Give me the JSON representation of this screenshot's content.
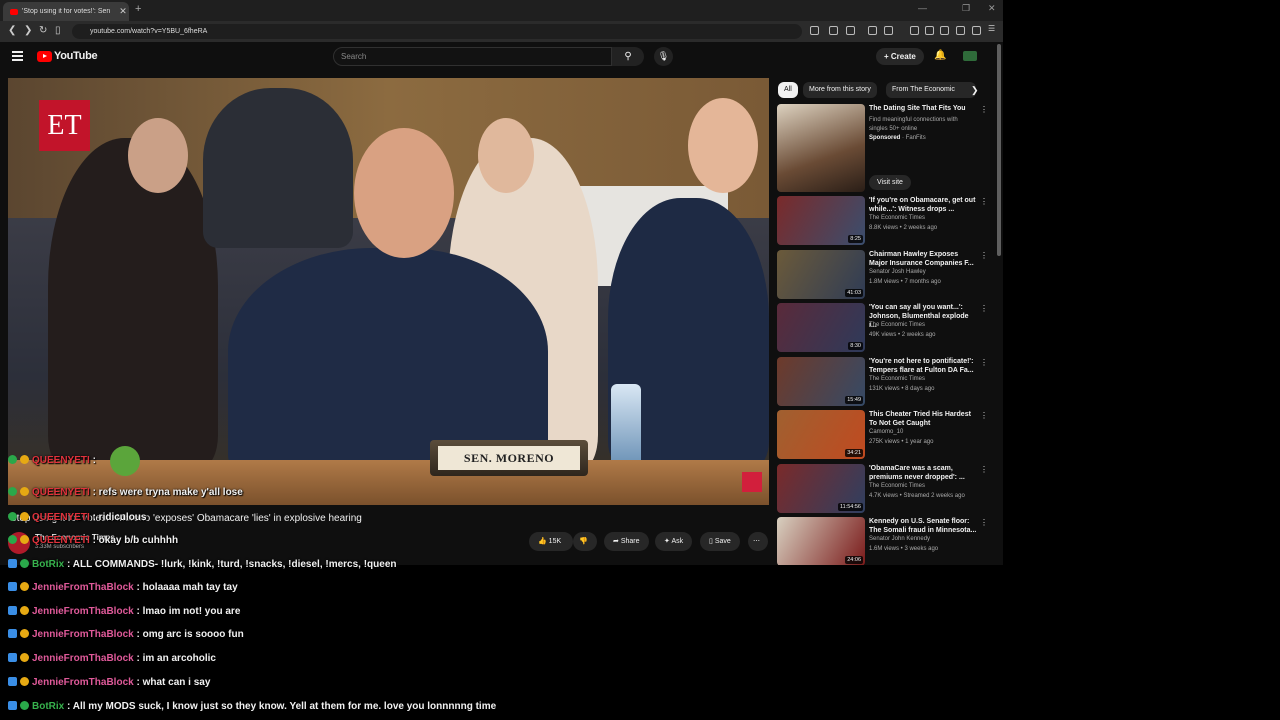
{
  "browser": {
    "tab_title": "'Stop using it for votes!': Sen",
    "tab_close": "✕",
    "new_tab": "+",
    "url": "youtube.com/watch?v=Y5BU_6fheRA",
    "controls": [
      "—",
      "❐",
      "✕"
    ]
  },
  "youtube": {
    "logo_text": "YouTube",
    "search_placeholder": "Search",
    "create_label": "Create"
  },
  "video": {
    "nameplate": "SEN. MORENO",
    "logo": "ET",
    "title": "'Stop using it for votes!': Moreno 'exposes' Obamacare 'lies' in explosive hearing",
    "channel": "The Economic Times",
    "subscribers": "3.33M subscribers",
    "likes": "15K",
    "share": "Share",
    "ask": "Ask",
    "save": "Save"
  },
  "sidebar": {
    "chips": [
      "All",
      "More from this story",
      "From The Economic"
    ],
    "ad": {
      "title": "The Dating Site That Fits You",
      "desc": "Find meaningful connections with singles 50+ online",
      "sponsored": "Sponsored",
      "advertiser": "FanFits",
      "visit": "Visit site"
    },
    "videos": [
      {
        "title": "'If you're on Obamacare, get out while...': Witness drops ...",
        "channel": "The Economic Times",
        "meta": "8.8K views • 2 weeks ago",
        "duration": "8:25"
      },
      {
        "title": "Chairman Hawley Exposes Major Insurance Companies F...",
        "channel": "Senator Josh Hawley",
        "meta": "1.8M views • 7 months ago",
        "duration": "41:03"
      },
      {
        "title": "'You can say all you want...': Johnson, Blumenthal explode i...",
        "channel": "The Economic Times",
        "meta": "49K views • 2 weeks ago",
        "duration": "8:30"
      },
      {
        "title": "'You're not here to pontificate!': Tempers flare at Fulton DA Fa...",
        "channel": "The Economic Times",
        "meta": "131K views • 8 days ago",
        "duration": "15:49"
      },
      {
        "title": "This Cheater Tried His Hardest To Not Get Caught",
        "channel": "Camomo_10",
        "meta": "275K views • 1 year ago",
        "duration": "34:21"
      },
      {
        "title": "'ObamaCare was a scam, premiums never dropped': ...",
        "channel": "The Economic Times",
        "meta": "4.7K views • Streamed 2 weeks ago",
        "duration": "11:54:56"
      },
      {
        "title": "Kennedy on U.S. Senate floor: The Somali fraud in Minnesota...",
        "channel": "Senator John Kennedy",
        "meta": "1.6M views • 3 weeks ago",
        "duration": "24:06"
      }
    ]
  },
  "chat": [
    {
      "user": "QUEENYETI",
      "msg": " :",
      "color": "red"
    },
    {
      "user": "QUEENYETI",
      "msg": " : refs were tryna make y'all lose",
      "color": "red"
    },
    {
      "user": "QUEENYETI",
      "msg": " : ridiculous",
      "color": "red"
    },
    {
      "user": "QUEENYETI",
      "msg": " : okay b/b cuhhhh",
      "color": "red"
    },
    {
      "user": "BotRix",
      "msg": " : ALL COMMANDS- !lurk, !kink, !turd, !snacks, !diesel, !mercs, !queen",
      "color": "green"
    },
    {
      "user": "JennieFromThaBlock",
      "msg": " : holaaaa mah tay tay",
      "color": "pink"
    },
    {
      "user": "JennieFromThaBlock",
      "msg": " : lmao im not! you are",
      "color": "pink"
    },
    {
      "user": "JennieFromThaBlock",
      "msg": " : omg arc is soooo fun",
      "color": "pink"
    },
    {
      "user": "JennieFromThaBlock",
      "msg": " : im an arcoholic",
      "color": "pink"
    },
    {
      "user": "JennieFromThaBlock",
      "msg": " : what can i say",
      "color": "pink"
    },
    {
      "user": "BotRix",
      "msg": " : All my MODS suck, I know just so they know. Yell at them for me. love you lonnnnng time",
      "color": "green"
    }
  ]
}
